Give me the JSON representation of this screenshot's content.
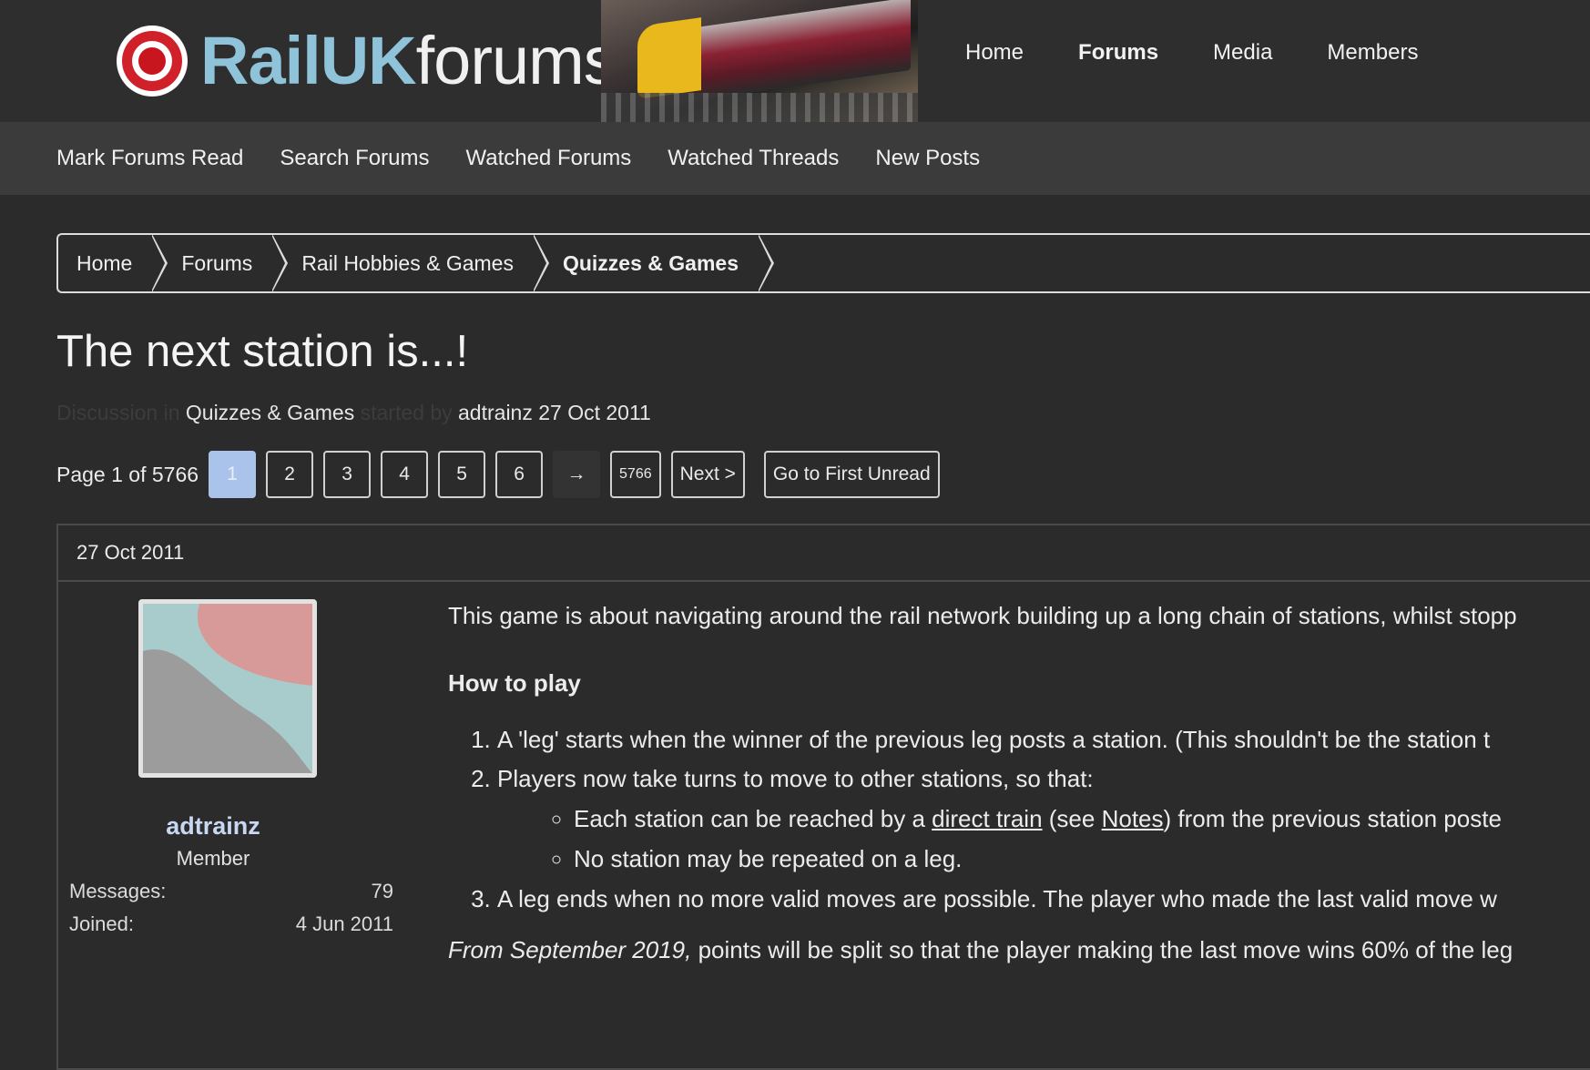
{
  "logo": {
    "bold": "RailUK",
    "regular": "forums"
  },
  "top_nav": [
    "Home",
    "Forums",
    "Media",
    "Members"
  ],
  "sub_nav": [
    "Mark Forums Read",
    "Search Forums",
    "Watched Forums",
    "Watched Threads",
    "New Posts"
  ],
  "breadcrumb": [
    "Home",
    "Forums",
    "Rail Hobbies & Games",
    "Quizzes & Games"
  ],
  "thread": {
    "title": "The next station is...!",
    "meta_prefix": "Discussion in",
    "forum": "Quizzes & Games",
    "meta_started_by": "started by",
    "author": "adtrainz",
    "date": "27 Oct 2011"
  },
  "pagination": {
    "label": "Page 1 of 5766",
    "pages": [
      "1",
      "2",
      "3",
      "4",
      "5",
      "6"
    ],
    "skip": "→",
    "last": "5766",
    "next": "Next >",
    "first_unread": "Go to First Unread"
  },
  "post": {
    "date": "27 Oct 2011",
    "username": "adtrainz",
    "role": "Member",
    "messages_label": "Messages:",
    "messages_value": "79",
    "joined_label": "Joined:",
    "joined_value": "4 Jun 2011",
    "intro": "This game is about navigating around the rail network building up a long chain of stations, whilst stopp",
    "how_to_play": "How to play",
    "rule1": "A 'leg' starts when the winner of the previous leg posts a station. (This shouldn't be the station t",
    "rule2": "Players now take turns to move to other stations, so that:",
    "sub1_before": "Each station can be reached by a ",
    "sub1_link1": "direct train",
    "sub1_mid": " (see ",
    "sub1_link2": "Notes",
    "sub1_after": ") from the previous station poste",
    "sub2": "No station may be repeated on a leg.",
    "rule3": "A leg ends when no more valid moves are possible. The player who made the last valid move w",
    "from_italic": "From September 2019,",
    "from_rest": " points will be split so that the player making the last move wins 60% of the leg"
  },
  "colors": {
    "background": "#2b2b2b",
    "header": "#2e2e2e",
    "subnav": "#3b3b3b",
    "current_page": "#aac3eb",
    "username": "#c9d8f2",
    "logo_red": "#d0202a",
    "logo_blue": "#8fc3d9"
  }
}
